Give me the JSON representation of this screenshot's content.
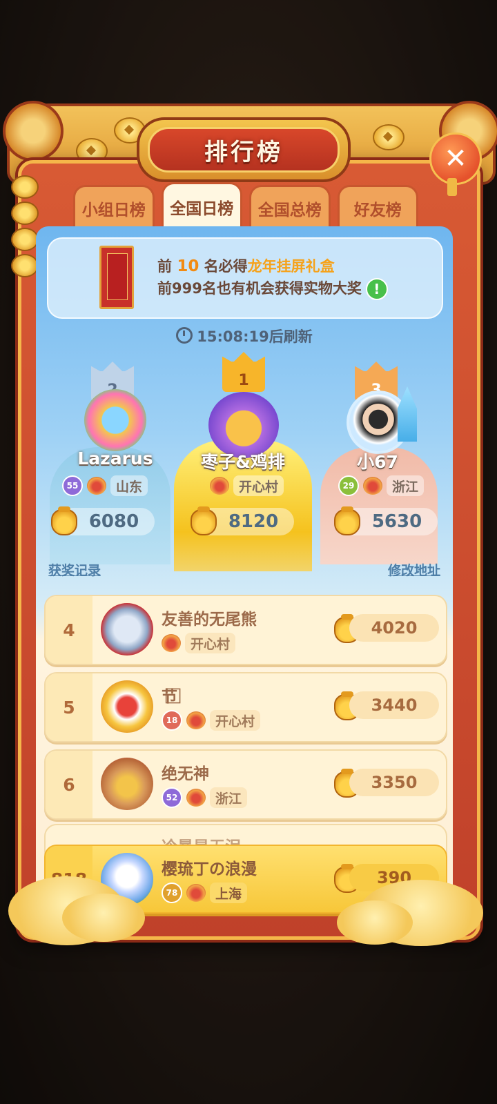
{
  "title": "排行榜",
  "tabs": [
    "小组日榜",
    "全国日榜",
    "全国总榜",
    "好友榜"
  ],
  "active_tab": "全国日榜",
  "banner": {
    "line1_prefix": "前",
    "line1_num": "10",
    "line1_mid": "名必得",
    "line1_highlight": "龙年挂屏礼盒",
    "line2": "前999名也有机会获得实物大奖"
  },
  "refresh_text": "15:08:19后刷新",
  "podium": [
    {
      "rank": "1",
      "name": "枣子&鸡排",
      "region": "开心村",
      "score": "8120"
    },
    {
      "rank": "2",
      "name": "Lazarus",
      "level": "55",
      "region": "山东",
      "score": "6080"
    },
    {
      "rank": "3",
      "name": "小67",
      "level": "29",
      "region": "浙江",
      "score": "5630"
    }
  ],
  "links": {
    "left": "获奖记录",
    "right": "修改地址"
  },
  "rows": [
    {
      "rank": "4",
      "name": "友善的无尾熊",
      "region": "开心村",
      "score": "4020"
    },
    {
      "rank": "5",
      "name": "节 ⃞",
      "level": "18",
      "region": "开心村",
      "score": "3440"
    },
    {
      "rank": "6",
      "name": "绝无神",
      "level": "52",
      "region": "浙江",
      "score": "3350"
    }
  ],
  "partial_row_name": "冷暴是无泪",
  "me": {
    "rank": "818",
    "name": "樱琉丁の浪漫",
    "level": "78",
    "region": "上海",
    "score": "390"
  },
  "colors": {
    "frame": "#c0412a",
    "accent": "#f6a21a",
    "highlight": "#f7c739"
  },
  "icons": [
    "close-icon",
    "clock-icon",
    "info-icon",
    "bag-icon",
    "crown-icon",
    "lion-icon"
  ]
}
